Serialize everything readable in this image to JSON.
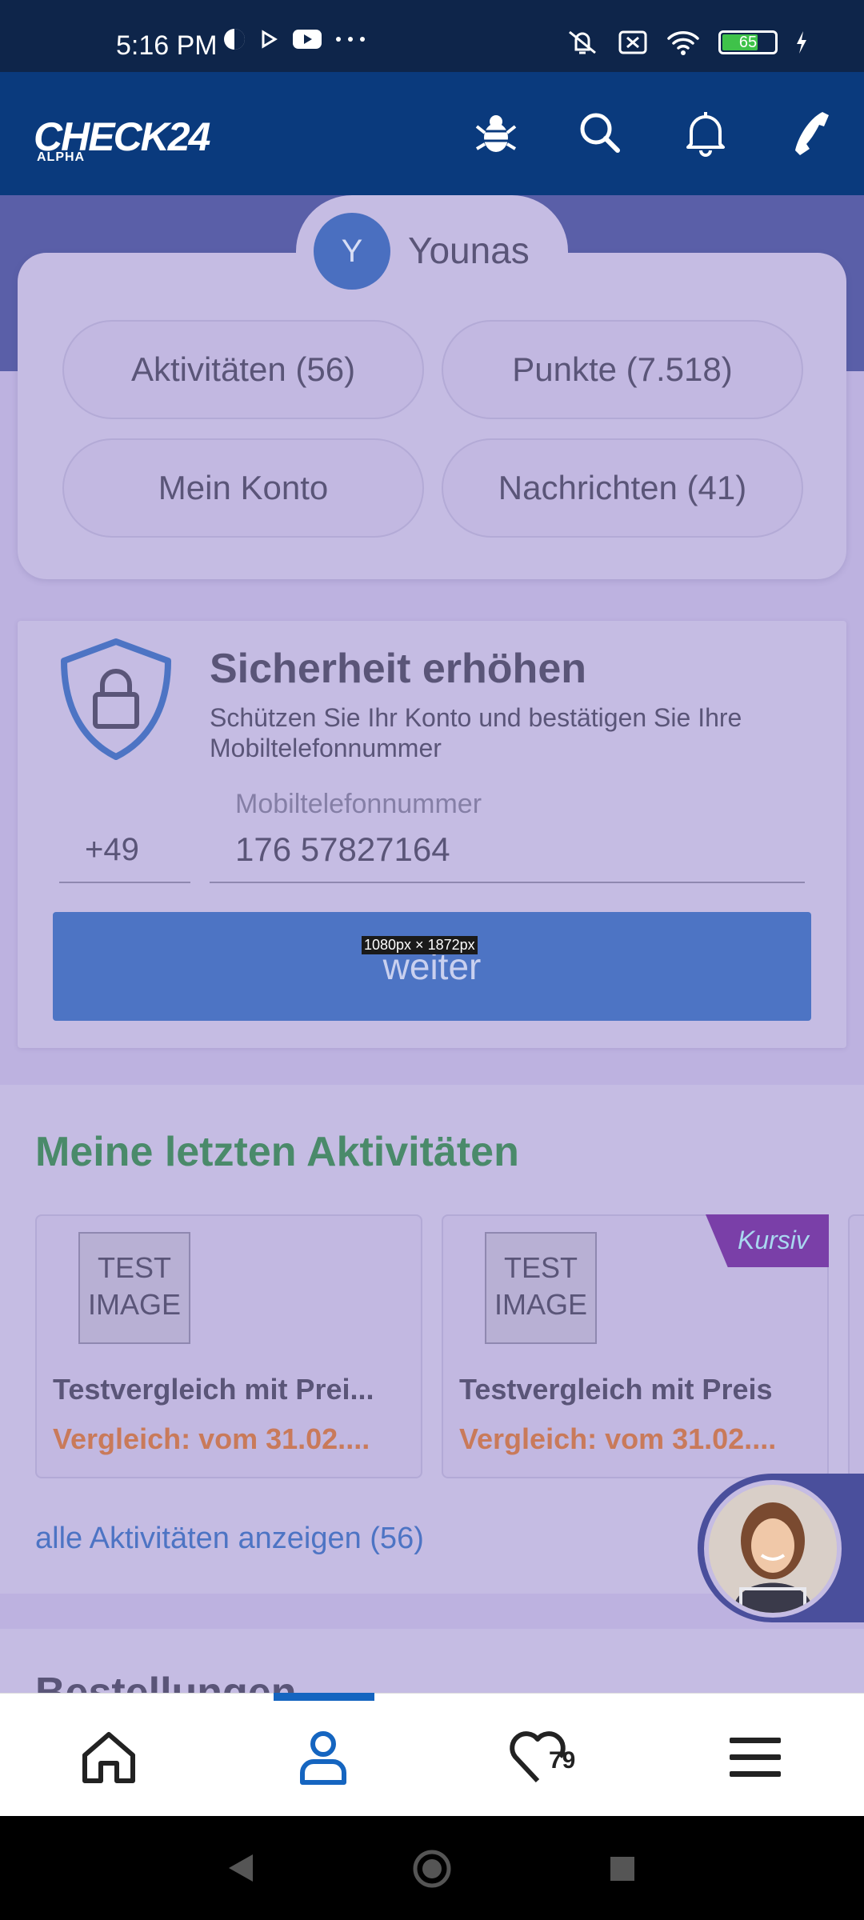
{
  "status_bar": {
    "time": "5:16 PM",
    "battery_level": "65",
    "icons": [
      "contact-icon",
      "play-icon",
      "youtube-icon",
      "more-icon",
      "mute-icon",
      "no-sim-icon",
      "wifi-icon",
      "battery-icon",
      "charging-icon"
    ]
  },
  "app_bar": {
    "logo_text": "CHECK24",
    "logo_sub": "ALPHA",
    "icons": [
      "bug-icon",
      "search-icon",
      "bell-icon",
      "phone-icon"
    ]
  },
  "profile": {
    "avatar_initial": "Y",
    "name": "Younas",
    "pills": {
      "activities": "Aktivitäten (56)",
      "points": "Punkte (7.518)",
      "account": "Mein Konto",
      "messages": "Nachrichten (41)"
    }
  },
  "security": {
    "title": "Sicherheit erhöhen",
    "subtitle": "Schützen Sie Ihr Konto und bestätigen Sie Ihre Mobiltelefonnummer",
    "prefix": "+49",
    "phone_label": "Mobiltelefonnummer",
    "phone_value": "176 57827164",
    "button_label": "weiter",
    "dimension_label": "1080px × 1872px"
  },
  "activities": {
    "title": "Meine letzten Aktivitäten",
    "cards": [
      {
        "image_text": "TEST IMAGE",
        "name": "Testvergleich mit Prei...",
        "date": "Vergleich: vom 31.02...."
      },
      {
        "image_text": "TEST IMAGE",
        "name": "Testvergleich mit Preis",
        "date": "Vergleich: vom 31.02....",
        "badge": "Kursiv"
      }
    ],
    "all_link": "alle Aktivitäten anzeigen (56)"
  },
  "orders": {
    "title": "Bestellungen"
  },
  "bottom_nav": {
    "items": [
      "home-icon",
      "profile-icon",
      "favorites-icon",
      "menu-icon"
    ],
    "active": "profile-icon",
    "favorites_count": "79"
  },
  "colors": {
    "app_bar": "#0a3a7d",
    "accent": "#4d74c4",
    "activity_title": "#4a8a6a",
    "date_text": "#c97a5a",
    "badge": "#7a3fa8"
  }
}
